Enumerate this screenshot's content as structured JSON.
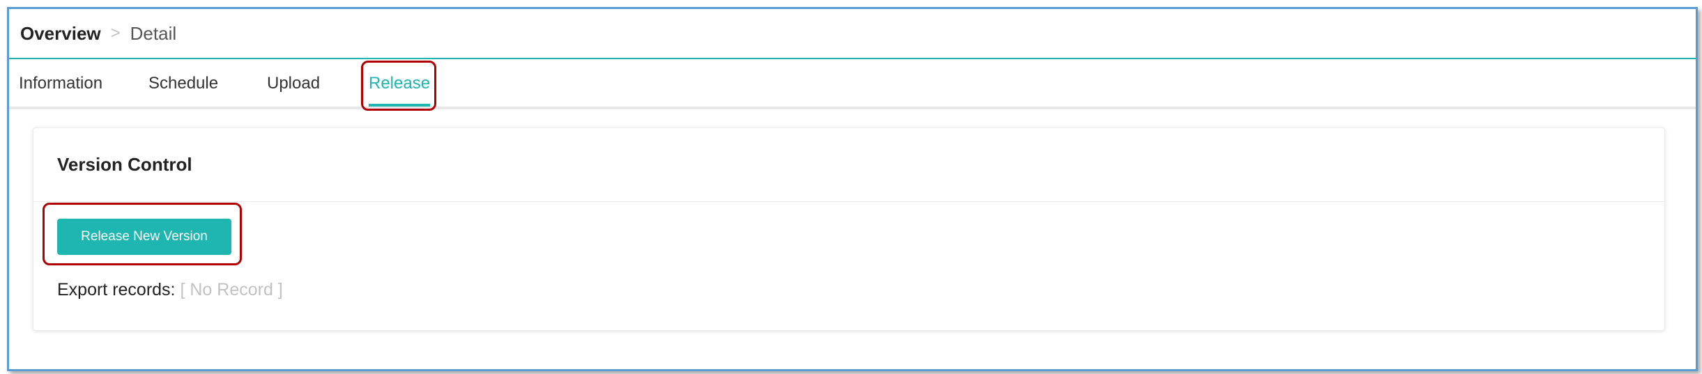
{
  "breadcrumb": {
    "root": "Overview",
    "separator": ">",
    "current": "Detail"
  },
  "tabs": [
    {
      "label": "Information",
      "active": false
    },
    {
      "label": "Schedule",
      "active": false
    },
    {
      "label": "Upload",
      "active": false
    },
    {
      "label": "Release",
      "active": true
    }
  ],
  "version_control": {
    "title": "Version Control",
    "release_button_label": "Release New Version",
    "export_label": "Export records:",
    "export_value": "[ No Record ]"
  },
  "colors": {
    "accent": "#1fb5b0",
    "highlight": "#b00000",
    "frame": "#5b9bd5"
  }
}
